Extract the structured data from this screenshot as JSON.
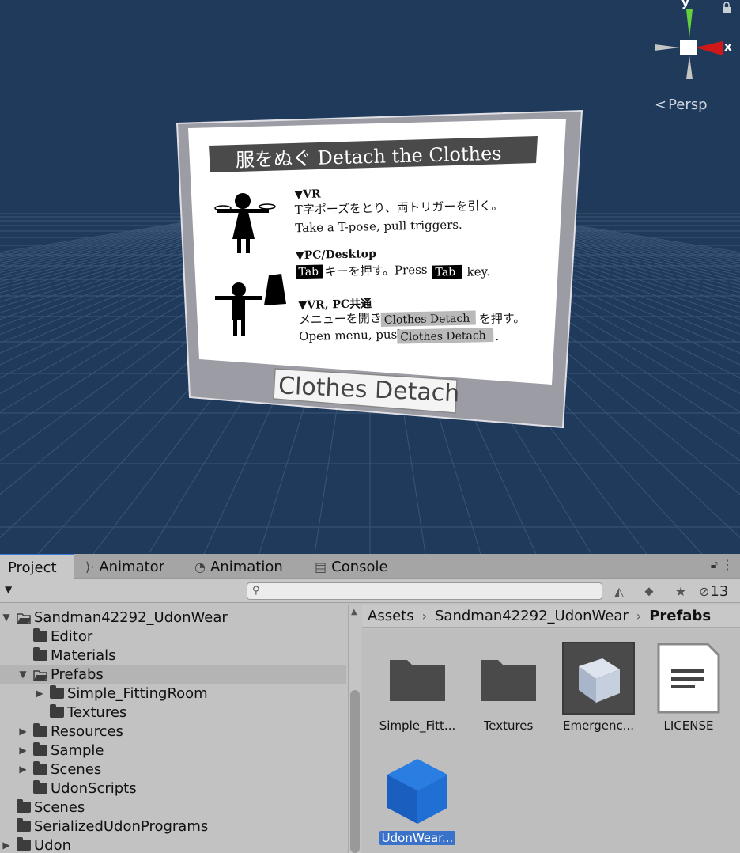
{
  "scene": {
    "gizmo": {
      "y_label": "y",
      "x_label": "x",
      "view_mode": "Persp",
      "lock_icon": "lock-icon",
      "persp_icon": "perspective-icon"
    },
    "board": {
      "title": "服をぬぐ Detach the Clothes",
      "vr_heading": "▼VR",
      "vr_jp": "T字ポーズをとり、両トリガーを引く。",
      "vr_en": "Take a T-pose, pull triggers.",
      "pc_heading": "▼PC/Desktop",
      "pc_key": "Tab",
      "pc_jp": "キーを押す。Press",
      "pc_key2": "Tab",
      "pc_en_tail": "key.",
      "common_heading": "▼VR, PC共通",
      "common_jp_a": "メニューを開き",
      "common_key": "Clothes Detach",
      "common_jp_b": "を押す。",
      "common_en": "Open menu, push",
      "common_key2": "Clothes Detach",
      "common_en_tail": ".",
      "button_label": "Clothes Detach"
    }
  },
  "panel": {
    "tabs": [
      {
        "label": "Project",
        "icon": "project-icon"
      },
      {
        "label": "Animator",
        "icon": "animator-icon"
      },
      {
        "label": "Animation",
        "icon": "animation-icon"
      },
      {
        "label": "Console",
        "icon": "console-icon"
      }
    ],
    "toolbar": {
      "search_placeholder": "",
      "hidden_count": "13"
    },
    "tree": [
      {
        "label": "Sandman42292_UdonWear",
        "indent": 0,
        "arrow": "▼",
        "open": true
      },
      {
        "label": "Editor",
        "indent": 1,
        "arrow": ""
      },
      {
        "label": "Materials",
        "indent": 1,
        "arrow": ""
      },
      {
        "label": "Prefabs",
        "indent": 1,
        "arrow": "▼",
        "open": true,
        "selected": true
      },
      {
        "label": "Simple_FittingRoom",
        "indent": 2,
        "arrow": "▶"
      },
      {
        "label": "Textures",
        "indent": 2,
        "arrow": ""
      },
      {
        "label": "Resources",
        "indent": 1,
        "arrow": "▶"
      },
      {
        "label": "Sample",
        "indent": 1,
        "arrow": "▶"
      },
      {
        "label": "Scenes",
        "indent": 1,
        "arrow": "▶"
      },
      {
        "label": "UdonScripts",
        "indent": 1,
        "arrow": ""
      },
      {
        "label": "Scenes",
        "indent": 0,
        "arrow": ""
      },
      {
        "label": "SerializedUdonPrograms",
        "indent": 0,
        "arrow": ""
      },
      {
        "label": "Udon",
        "indent": 0,
        "arrow": "▶"
      }
    ],
    "breadcrumb": [
      "Assets",
      "Sandman42292_UdonWear",
      "Prefabs"
    ],
    "assets": [
      {
        "label": "Simple_Fitt...",
        "icon": "folder-icon"
      },
      {
        "label": "Textures",
        "icon": "folder-icon"
      },
      {
        "label": "Emergenc...",
        "icon": "prefab-cube-icon"
      },
      {
        "label": "LICENSE",
        "icon": "text-file-icon"
      },
      {
        "label": "UdonWear...",
        "icon": "udon-cube-icon",
        "selected": true
      }
    ]
  }
}
